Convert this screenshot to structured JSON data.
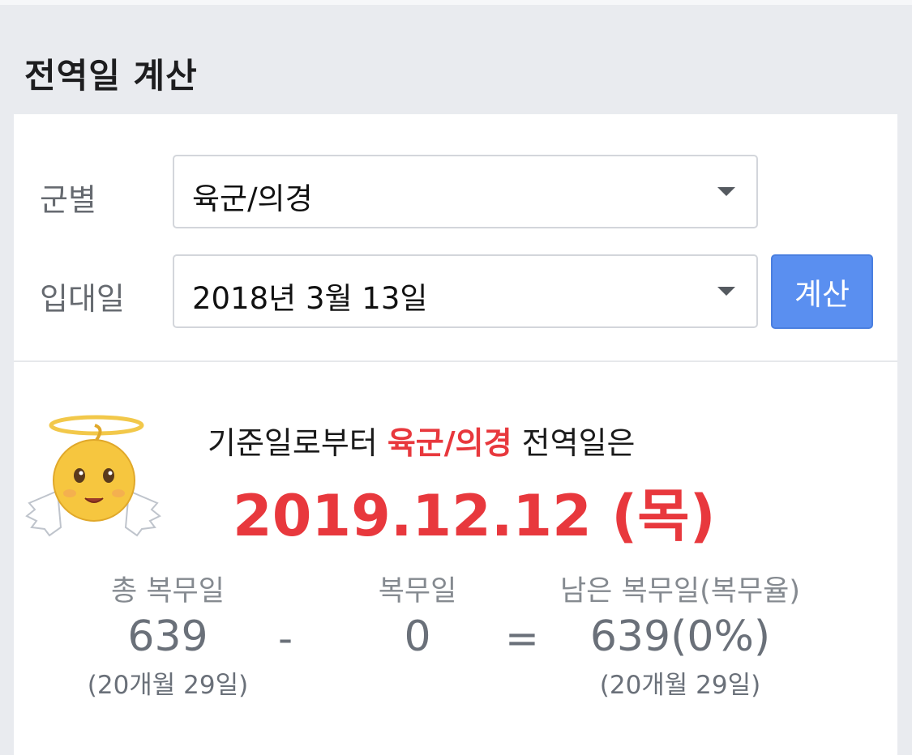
{
  "page": {
    "title": "전역일 계산"
  },
  "form": {
    "branch_label": "군별",
    "branch_value": "육군/의경",
    "enlist_label": "입대일",
    "enlist_value": "2018년 3월 13일",
    "calc_button": "계산"
  },
  "result": {
    "emoji": "baby-angel-icon",
    "prefix": "기준일로부터 ",
    "branch": "육군/의경",
    "suffix": " 전역일은",
    "discharge_date": "2019.12.12 (목)",
    "stats": {
      "total": {
        "label": "총 복무일",
        "value": "639",
        "sub": "(20개월 29일)"
      },
      "minus": "-",
      "served": {
        "label": "복무일",
        "value": "0"
      },
      "equals": "=",
      "remaining": {
        "label": "남은 복무일(복무율)",
        "value": "639(0%)",
        "sub": "(20개월 29일)"
      }
    }
  },
  "colors": {
    "accent_red": "#e8383d",
    "button_blue": "#5a8ff0",
    "background": "#e9ebef"
  }
}
